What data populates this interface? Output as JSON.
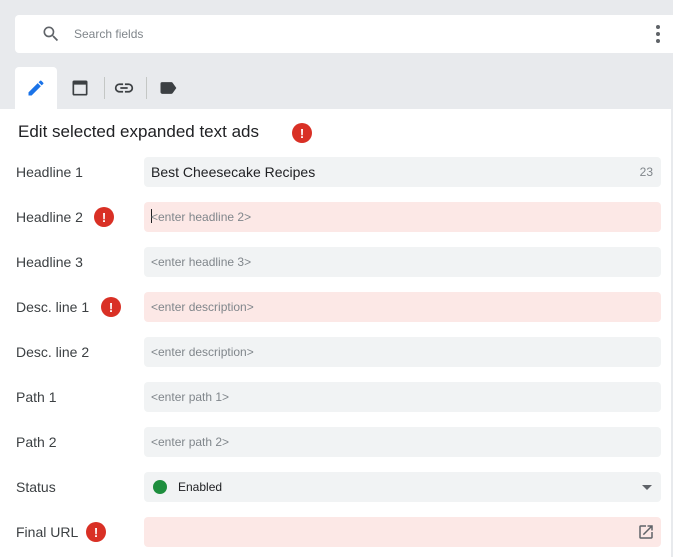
{
  "search": {
    "placeholder": "Search fields",
    "value": ""
  },
  "tabs": [
    {
      "icon": "pencil-icon",
      "active": true
    },
    {
      "icon": "window-icon",
      "active": false
    },
    {
      "icon": "link-icon",
      "active": false
    },
    {
      "icon": "label-icon",
      "active": false
    }
  ],
  "panel": {
    "title": "Edit selected expanded text ads",
    "title_has_error": true
  },
  "fields": {
    "headline1": {
      "label": "Headline 1",
      "value": "Best Cheesecake Recipes",
      "counter": "23",
      "placeholder": ""
    },
    "headline2": {
      "label": "Headline 2",
      "value": "",
      "placeholder": "<enter headline 2>",
      "error": true
    },
    "headline3": {
      "label": "Headline 3",
      "value": "",
      "placeholder": "<enter headline 3>"
    },
    "desc1": {
      "label": "Desc. line 1",
      "value": "",
      "placeholder": "<enter description>",
      "error": true
    },
    "desc2": {
      "label": "Desc. line 2",
      "value": "",
      "placeholder": "<enter description>"
    },
    "path1": {
      "label": "Path 1",
      "value": "",
      "placeholder": "<enter path 1>"
    },
    "path2": {
      "label": "Path 2",
      "value": "",
      "placeholder": "<enter path 2>"
    },
    "status": {
      "label": "Status",
      "value": "Enabled",
      "dot_color": "#1e8e3e"
    },
    "final_url": {
      "label": "Final URL",
      "value": "",
      "placeholder": "",
      "error": true,
      "icon": "open-in-new-icon"
    }
  },
  "colors": {
    "error": "#d93025",
    "error_field_bg": "#fce8e6",
    "field_bg": "#f1f3f4",
    "active_tab_icon": "#1a73e8"
  }
}
